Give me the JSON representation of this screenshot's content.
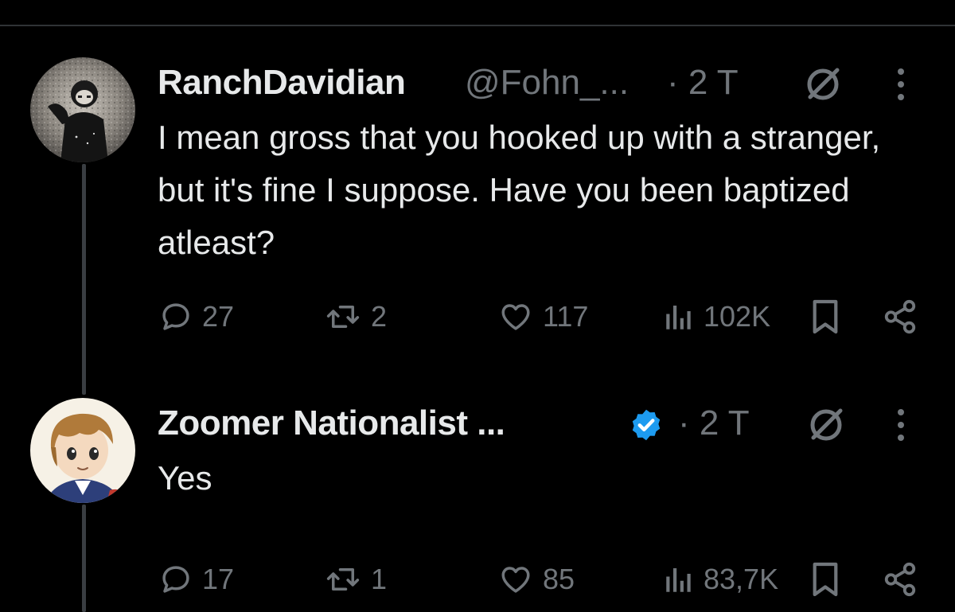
{
  "colors": {
    "background": "#000000",
    "primary_text": "#e7e9ea",
    "secondary_text": "#71767b",
    "thread_line": "#3a3e42",
    "verified_blue": "#1d9bf0"
  },
  "tweets": [
    {
      "display_name": "RanchDavidian",
      "handle": "@Fohn_...",
      "time": "· 2 T",
      "text": "I mean gross that you hooked up with a stranger, but it's fine I suppose. Have you been baptized atleast?",
      "verified": false,
      "actions": {
        "replies": "27",
        "reposts": "2",
        "likes": "117",
        "views": "102K"
      },
      "icons": [
        "grok-icon",
        "more-icon",
        "reply-icon",
        "repost-icon",
        "like-icon",
        "views-icon",
        "bookmark-icon",
        "share-icon"
      ]
    },
    {
      "display_name": "Zoomer Nationalist ...",
      "handle": "",
      "time": "· 2 T",
      "text": "Yes",
      "verified": true,
      "actions": {
        "replies": "17",
        "reposts": "1",
        "likes": "85",
        "views": "83,7K"
      },
      "icons": [
        "verified-icon",
        "grok-icon",
        "more-icon",
        "reply-icon",
        "repost-icon",
        "like-icon",
        "views-icon",
        "bookmark-icon",
        "share-icon"
      ]
    }
  ]
}
